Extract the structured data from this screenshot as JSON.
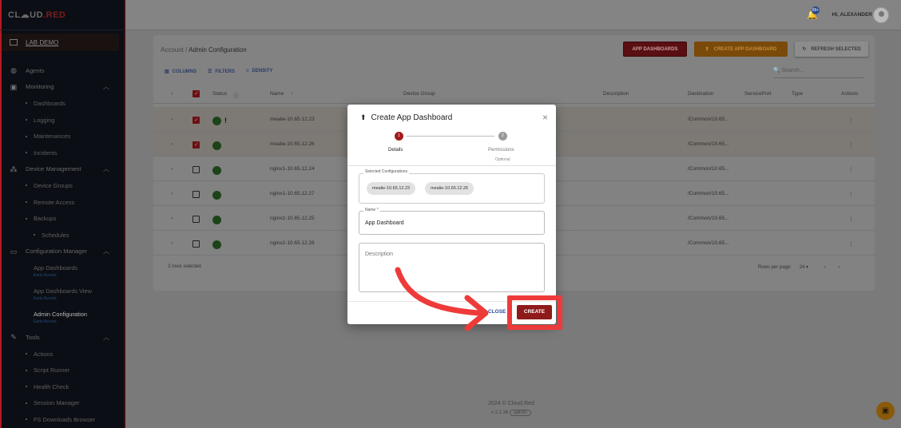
{
  "sidebar": {
    "logo_left": "CL☁UD",
    "logo_right": ".RED",
    "workspace": "LAB DEMO",
    "items": [
      {
        "label": "Agents",
        "icon": "globe-icon"
      },
      {
        "label": "Monitoring",
        "icon": "chart-icon"
      },
      {
        "label": "Dashboards"
      },
      {
        "label": "Logging"
      },
      {
        "label": "Maintenances"
      },
      {
        "label": "Incidents"
      },
      {
        "label": "Device Management",
        "icon": "network-icon"
      },
      {
        "label": "Device Groups"
      },
      {
        "label": "Remote Access"
      },
      {
        "label": "Backups"
      },
      {
        "label": "Schedules"
      },
      {
        "label": "Configuration Manager",
        "icon": "monitor-icon"
      },
      {
        "label": "App Dashboards",
        "sub": "Early Access"
      },
      {
        "label": "App Dashboards View",
        "sub": "Early Access"
      },
      {
        "label": "Admin Configuration",
        "sub": "Early Access"
      },
      {
        "label": "Tools",
        "icon": "wrench-icon"
      },
      {
        "label": "Actions"
      },
      {
        "label": "Script Runner"
      },
      {
        "label": "Health Check"
      },
      {
        "label": "Session Manager"
      },
      {
        "label": "FS Downloads Browser"
      }
    ]
  },
  "topbar": {
    "greeting": "HI, ALEXANDER",
    "badge": "99+"
  },
  "page": {
    "crumb_root": "Account",
    "crumb_sep": "/",
    "crumb_current": "Admin Configuration",
    "btn_app_dashboards": "APP DASHBOARDS",
    "btn_create": "CREATE APP DASHBOARD",
    "btn_refresh": "REFRESH SELECTED",
    "tool_columns": "COLUMNS",
    "tool_filters": "FILTERS",
    "tool_density": "DENSITY",
    "search_placeholder": "Search…",
    "headers": {
      "status": "Status",
      "name": "Name",
      "group": "Device Group",
      "description": "Description",
      "destination": "Destination",
      "port": "ServicePort",
      "type": "Type",
      "actions": "Actions"
    },
    "rows": [
      {
        "name": "mealie-10.65.12.23",
        "dest": "/Common/10.65...",
        "checked": true,
        "warn": "!"
      },
      {
        "name": "mealie-10.65.12.26",
        "dest": "/Common/10.65...",
        "checked": true
      },
      {
        "name": "nginx1-10.65.12.24",
        "dest": "/Common/10.65...",
        "checked": false
      },
      {
        "name": "nginx1-10.65.12.27",
        "dest": "/Common/10.65...",
        "checked": false
      },
      {
        "name": "nginx2-10.65.12.25",
        "dest": "/Common/10.65...",
        "checked": false
      },
      {
        "name": "nginx2-10.65.12.28",
        "dest": "/Common/10.65...",
        "checked": false
      }
    ],
    "rows_selected": "2 rows selected",
    "rows_per_page_label": "Rows per page:",
    "rows_per_page_value": "24"
  },
  "footer": {
    "copyright": "2024 © Cloud.Red",
    "version": "v 2.1.36",
    "env": "admin"
  },
  "modal": {
    "title": "Create App Dashboard",
    "step1_num": "1",
    "step2_num": "2",
    "step1": "Details",
    "step2": "Permissions",
    "step2_sub": "Optional",
    "configs_label": "Selected Configurations",
    "chips": [
      "mealie-10.65.12.23",
      "mealie-10.65.12.26"
    ],
    "name_label": "Name *",
    "name_value": "App Dashboard",
    "desc_placeholder": "Description",
    "close": "CLOSE",
    "create": "CREATE"
  },
  "colors": {
    "accent": "#8e1a1a",
    "highlight": "#ef3a3a",
    "status_ok": "#1c4418"
  }
}
